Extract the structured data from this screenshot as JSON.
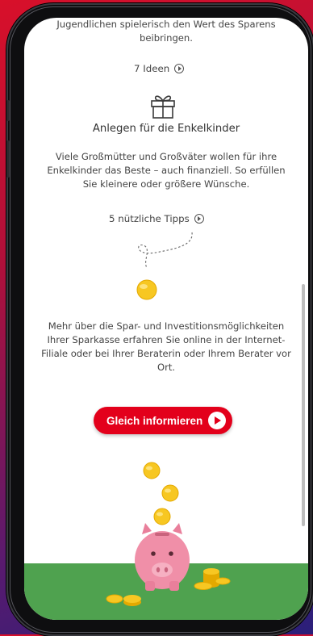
{
  "intro_text": "Jugendlichen spielerisch den Wert des Sparens beibringen.",
  "ideas_link": "7 Ideen",
  "section_heading": "Anlegen für die Enkelkinder",
  "section_text": "Viele Großmütter und Großväter wollen für ihre Enkelkinder das Beste – auch finanziell. So erfüllen Sie kleinere oder größere Wünsche.",
  "tips_link": "5 nützliche Tipps",
  "info_text": "Mehr über die Spar- und Investitionsmöglichkeiten Ihrer Sparkasse erfahren Sie online in der Internet-Filiale oder bei Ihrer Beraterin oder Ihrem Berater vor Ort.",
  "cta_label": "Gleich informieren",
  "icons": [
    "gift-icon",
    "play-icon",
    "coin-icon",
    "piggy-bank-icon"
  ],
  "colors": {
    "accent": "#e3001b",
    "grass": "#4fa24f",
    "coin": "#f7c722",
    "piggy": "#f08fa8"
  }
}
